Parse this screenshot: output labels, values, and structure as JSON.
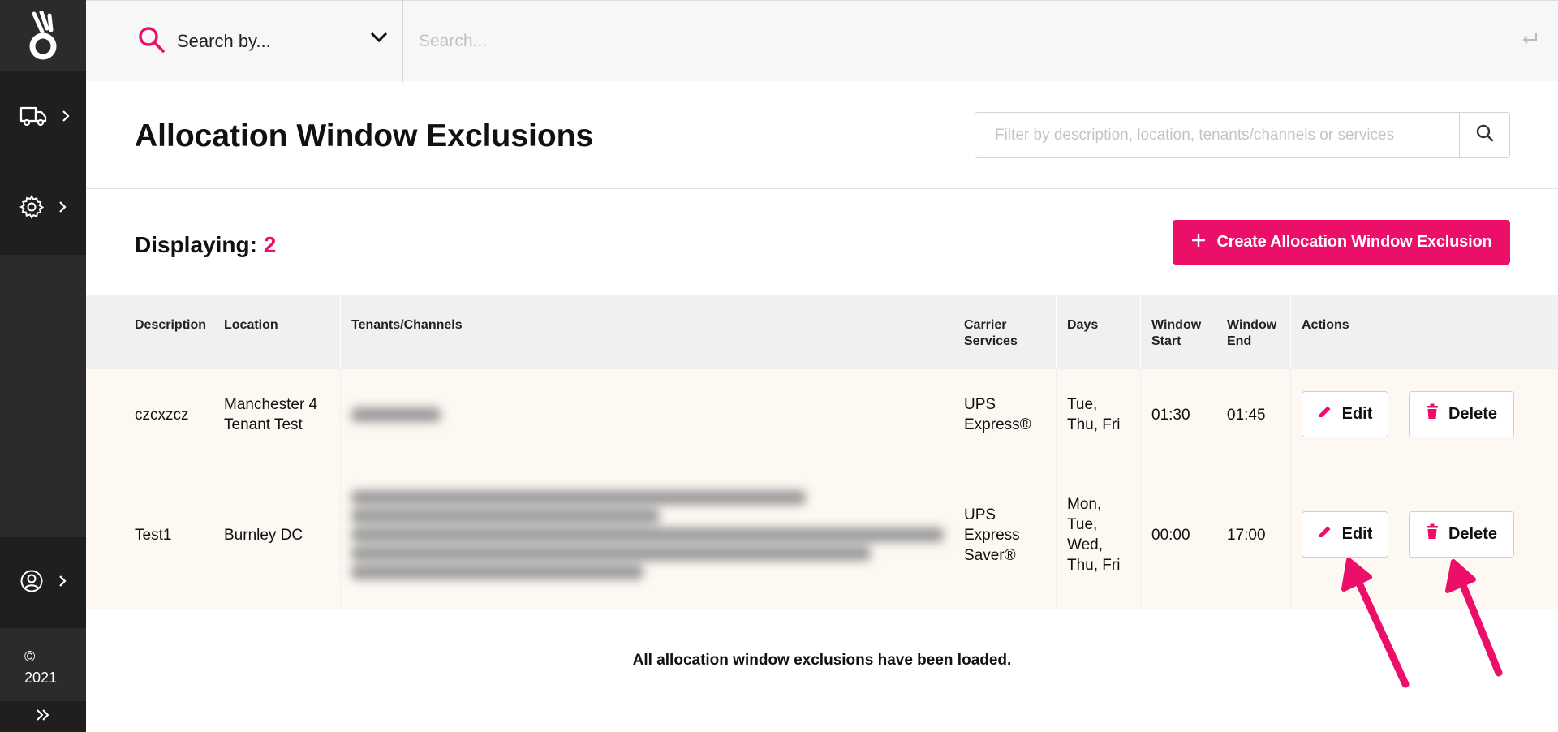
{
  "sidebar": {
    "logo_icon": "brand-logo-icon",
    "items": [
      {
        "icon": "truck-icon"
      },
      {
        "icon": "gear-icon"
      },
      {
        "icon": "user-icon"
      }
    ],
    "copyright_symbol": "©",
    "copyright_year": "2021"
  },
  "topbar": {
    "search_by_label": "Search by...",
    "search_placeholder": "Search..."
  },
  "header": {
    "title": "Allocation Window Exclusions",
    "filter_placeholder": "Filter by description, location, tenants/channels or services"
  },
  "summary": {
    "displaying_label": "Displaying:",
    "count": "2",
    "create_button": "Create Allocation Window Exclusion"
  },
  "table": {
    "headers": {
      "description": "Description",
      "location": "Location",
      "tenants": "Tenants/Channels",
      "carrier_line1": "Carrier",
      "carrier_line2": "Services",
      "days": "Days",
      "wstart_line1": "Window",
      "wstart_line2": "Start",
      "wend_line1": "Window",
      "wend_line2": "End",
      "actions": "Actions"
    },
    "rows": [
      {
        "description": "czcxzcz",
        "location_line1": "Manchester 4",
        "location_line2": "Tenant Test",
        "carrier_line1": "UPS",
        "carrier_line2": "Express®",
        "carrier_line3": "",
        "days_line1": "Tue,",
        "days_line2": "Thu, Fri",
        "days_line3": "",
        "days_line4": "",
        "window_start": "01:30",
        "window_end": "01:45",
        "edit": "Edit",
        "delete": "Delete"
      },
      {
        "description": "Test1",
        "location_line1": "Burnley DC",
        "location_line2": "",
        "carrier_line1": "UPS",
        "carrier_line2": "Express",
        "carrier_line3": "Saver®",
        "days_line1": "Mon,",
        "days_line2": "Tue,",
        "days_line3": "Wed,",
        "days_line4": "Thu, Fri",
        "window_start": "00:00",
        "window_end": "17:00",
        "edit": "Edit",
        "delete": "Delete"
      }
    ],
    "footer_message": "All allocation window exclusions have been loaded."
  },
  "colors": {
    "accent": "#ec0f6a",
    "sidebar_bg": "#2b2b2b",
    "row_bg": "#fdf8f2",
    "header_bg": "#f0f0f0"
  }
}
